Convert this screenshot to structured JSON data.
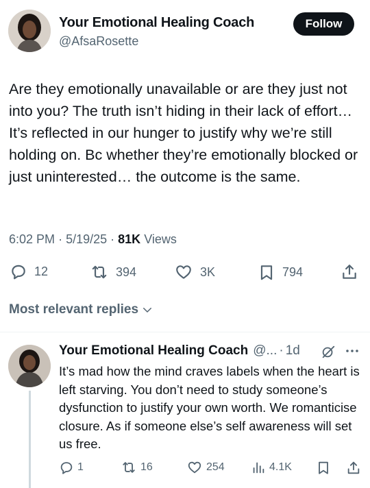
{
  "tweet": {
    "author_name": "Your Emotional Healing Coach",
    "author_handle": "@AfsaRosette",
    "follow_label": "Follow",
    "text": "Are they emotionally unavailable or are they just not into you? The truth isn’t hiding in their lack of effort…It’s reflected in our hunger to justify why we’re still holding on. Bc whether they’re emotionally blocked or just uninterested… the outcome is the same.",
    "time": "6:02 PM",
    "date": "5/19/25",
    "views_count": "81K",
    "views_label": "Views",
    "actions": {
      "replies": "12",
      "reposts": "394",
      "likes": "3K",
      "bookmarks": "794"
    }
  },
  "replies_sort_label": "Most relevant replies",
  "reply": {
    "author_name": "Your Emotional Healing Coach",
    "author_handle": "@...",
    "separator": "·",
    "time": "1d",
    "text": "It’s mad how the mind craves labels when the heart is left starving. You don’t need to study someone’s dysfunction to justify your own worth. We romanticise closure. As if someone else’s self awareness will set us free.",
    "actions": {
      "replies": "1",
      "reposts": "16",
      "likes": "254",
      "views": "4.1K"
    }
  },
  "colors": {
    "text_primary": "#0f1419",
    "text_secondary": "#536471",
    "follow_bg": "#0f1419",
    "divider": "#eff3f4"
  },
  "icons": [
    "reply-icon",
    "repost-icon",
    "like-icon",
    "bookmark-icon",
    "share-icon",
    "chevron-down-icon",
    "grok-icon",
    "more-icon",
    "views-icon"
  ]
}
